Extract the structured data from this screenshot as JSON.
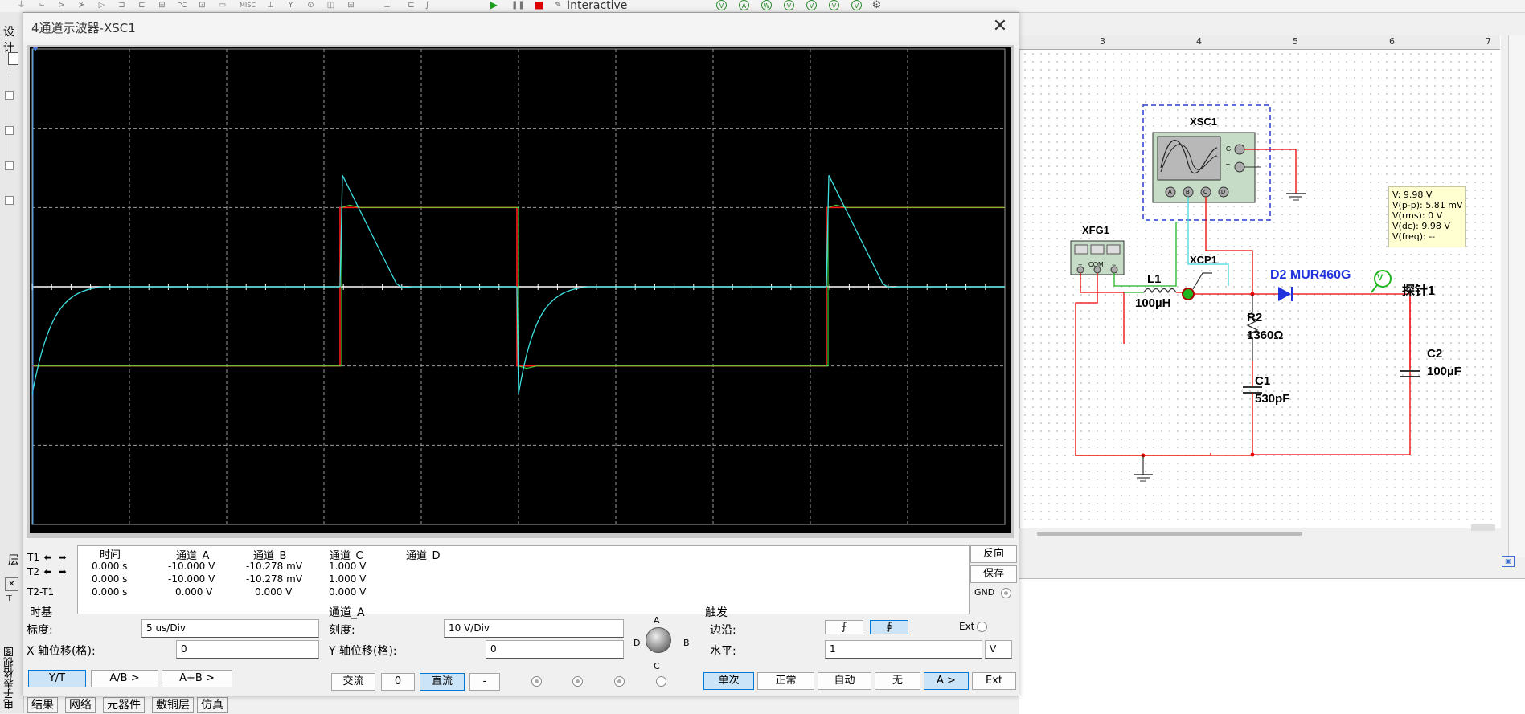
{
  "toolbar": {
    "interactive_label": "Interactive",
    "misc_label": "MISC",
    "instrument_icons": [
      "V",
      "A",
      "W",
      "V",
      "V",
      "V",
      "V"
    ]
  },
  "left_strip": {
    "design_tab": "设计",
    "layer_tab": "层",
    "vertical_label": "电子表格视图"
  },
  "bottom_tabs": [
    "结果",
    "网络",
    "元器件",
    "敷铜层",
    "仿真"
  ],
  "ruler": {
    "numbers": [
      "3",
      "4",
      "5",
      "6",
      "7"
    ]
  },
  "schematic": {
    "xsc1_label": "XSC1",
    "xfg1_label": "XFG1",
    "xcp1_label": "XCP1",
    "l1_name": "L1",
    "l1_value": "100µH",
    "d2_label": "D2 MUR460G",
    "probe_label": "探针1",
    "r2_name": "R2",
    "r2_value": "1360Ω",
    "c1_name": "C1",
    "c1_value": "530pF",
    "c2_name": "C2",
    "c2_value": "100µF",
    "scope_pins": [
      "A",
      "B",
      "C",
      "D"
    ],
    "scope_pins_right": [
      "G",
      "T"
    ],
    "fg_pins": [
      "+",
      "COM",
      "−"
    ],
    "probe_symbol": "V",
    "probe_readings": [
      "V: 9.98 V",
      "V(p-p): 5.81 mV",
      "V(rms): 0 V",
      "V(dc): 9.98 V",
      "V(freq): --"
    ]
  },
  "scope": {
    "title": "4通道示波器-XSC1",
    "close_glyph": "✕",
    "colors": {
      "channel_a": "#ff1a1a",
      "channel_b": "#44ee44",
      "channel_c": "#40e0e0",
      "axis": "#ffffff",
      "grid": "#9a9a9a"
    },
    "readout": {
      "headers": [
        "时间",
        "通道_A",
        "通道_B",
        "通道_C",
        "通道_D"
      ],
      "rows": [
        {
          "label": "T1",
          "cells": [
            "0.000 s",
            "-10.000 V",
            "-10.278 mV",
            "1.000 V"
          ]
        },
        {
          "label": "T2",
          "cells": [
            "0.000 s",
            "-10.000 V",
            "-10.278 mV",
            "1.000 V"
          ]
        },
        {
          "label": "T2-T1",
          "cells": [
            "0.000 s",
            "0.000 V",
            "0.000 V",
            "0.000 V"
          ]
        }
      ],
      "arrows": [
        "⬅",
        "➡"
      ]
    },
    "side_buttons": {
      "reverse": "反向",
      "save": "保存",
      "gnd": "GND"
    },
    "timebase": {
      "title": "时基",
      "scale_label": "标度:",
      "scale_value": "5 us/Div",
      "xpos_label": "X 轴位移(格):",
      "xpos_value": "0",
      "modes": [
        "Y/T",
        "A/B >",
        "A+B >"
      ]
    },
    "channel": {
      "title": "通道_A",
      "scale_label": "刻度:",
      "scale_value": "10  V/Div",
      "ypos_label": "Y 轴位移(格):",
      "ypos_value": "0",
      "coupling": [
        "交流",
        "0",
        "直流",
        "-"
      ],
      "knob_labels": [
        "A",
        "B",
        "C",
        "D"
      ]
    },
    "trigger": {
      "title": "触发",
      "edge_label": "边沿:",
      "edge_buttons": [
        "⨍",
        "⨖"
      ],
      "ext_label": "Ext",
      "level_label": "水平:",
      "level_value": "1",
      "level_unit": "V",
      "modes": [
        "单次",
        "正常",
        "自动",
        "无",
        "A >",
        "Ext"
      ]
    }
  }
}
